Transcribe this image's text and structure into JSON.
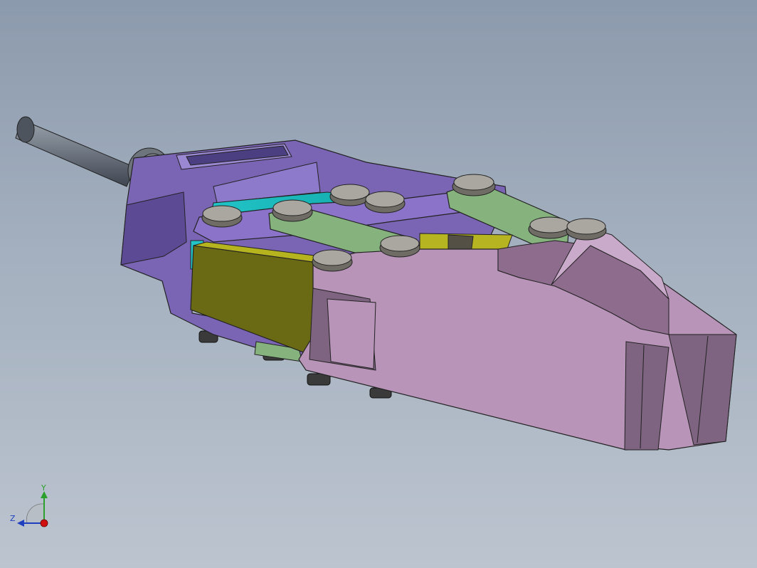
{
  "viewport": {
    "background_top": "#8c9aad",
    "background_bottom": "#bcc4cf"
  },
  "model": {
    "parts": [
      {
        "name": "shaft",
        "color": "#5d6570"
      },
      {
        "name": "housing",
        "color": "#7a64b4"
      },
      {
        "name": "slider-plate",
        "color": "#2fc6c3"
      },
      {
        "name": "linkage-arm",
        "color": "#86b27e"
      },
      {
        "name": "rocker-block",
        "color": "#6b6a14"
      },
      {
        "name": "jaw",
        "color": "#b894b8"
      },
      {
        "name": "pin",
        "color": "#6e6c64"
      }
    ]
  },
  "triad": {
    "y_label": "Y",
    "z_label": "Z",
    "y_color": "#2ca02c",
    "z_color": "#1f3fbf",
    "x_color": "#d01010"
  }
}
